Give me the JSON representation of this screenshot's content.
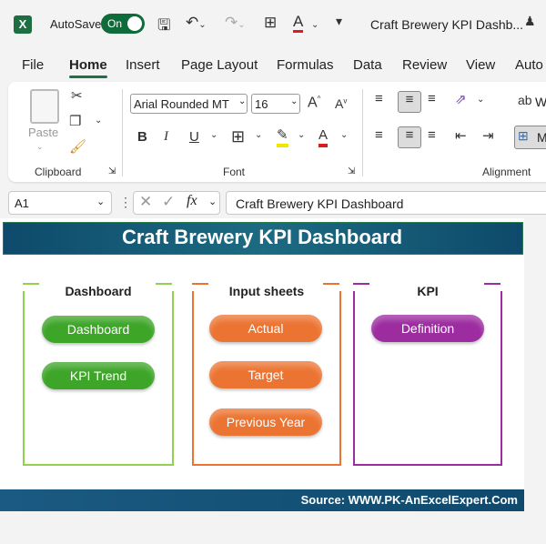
{
  "titlebar": {
    "logo": "X",
    "autosave_label": "AutoSave",
    "toggle_label": "On",
    "doc_title": "Craft Brewery KPI Dashb...",
    "icons": [
      "save-icon",
      "undo-icon",
      "redo-icon",
      "borders-icon",
      "font-color-icon",
      "customize-icon",
      "share-icon"
    ]
  },
  "tabs": [
    "File",
    "Home",
    "Insert",
    "Page Layout",
    "Formulas",
    "Data",
    "Review",
    "View",
    "Auto"
  ],
  "active_tab": "Home",
  "ribbon": {
    "clipboard": {
      "paste_label": "Paste",
      "group_label": "Clipboard"
    },
    "font": {
      "font_name": "Arial Rounded MT",
      "font_size": "16",
      "group_label": "Font",
      "bold": "B",
      "italic": "I",
      "underline": "U"
    },
    "alignment": {
      "group_label": "Alignment",
      "wrap_partial": "W",
      "merge_partial": "M"
    }
  },
  "formula_bar": {
    "cell_ref": "A1",
    "fx": "fx",
    "content": "Craft Brewery KPI Dashboard"
  },
  "sheet": {
    "title": "Craft Brewery KPI Dashboard",
    "panels": [
      {
        "title": "Dashboard",
        "color": "#92d050",
        "buttons": [
          "Dashboard",
          "KPI Trend"
        ]
      },
      {
        "title": "Input sheets",
        "color": "#ec7432",
        "buttons": [
          "Actual",
          "Target",
          "Previous Year"
        ]
      },
      {
        "title": "KPI",
        "color": "#9c2ca0",
        "buttons": [
          "Definition"
        ]
      }
    ],
    "footer": "Source: WWW.PK-AnExcelExpert.Com"
  },
  "colors": {
    "excel_green": "#1e7145",
    "banner": "#0e4a6b",
    "green_pill": "#3da528",
    "orange_pill": "#ec7432",
    "purple_pill": "#9c2ca0"
  }
}
